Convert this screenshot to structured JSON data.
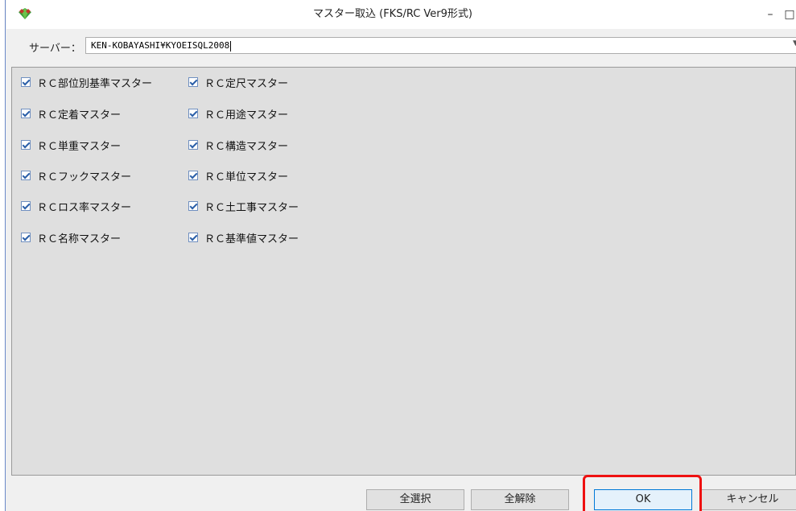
{
  "window": {
    "title": "マスター取込 (FKS/RC Ver9形式)",
    "icon": "app-logo-icon",
    "controls": {
      "minimize": "–",
      "maximize": "□",
      "close": "✕"
    }
  },
  "server": {
    "label": "サーバー：",
    "value": "KEN-KOBAYASHI¥KYOEISQL2008"
  },
  "masters": {
    "left": [
      {
        "label": "ＲＣ部位別基準マスター",
        "checked": true
      },
      {
        "label": "ＲＣ定着マスター",
        "checked": true
      },
      {
        "label": "ＲＣ単重マスター",
        "checked": true
      },
      {
        "label": "ＲＣフックマスター",
        "checked": true
      },
      {
        "label": "ＲＣロス率マスター",
        "checked": true
      },
      {
        "label": "ＲＣ名称マスター",
        "checked": true
      }
    ],
    "right": [
      {
        "label": "ＲＣ定尺マスター",
        "checked": true
      },
      {
        "label": "ＲＣ用途マスター",
        "checked": true
      },
      {
        "label": "ＲＣ構造マスター",
        "checked": true
      },
      {
        "label": "ＲＣ単位マスター",
        "checked": true
      },
      {
        "label": "ＲＣ土工事マスター",
        "checked": true
      },
      {
        "label": "ＲＣ基準値マスター",
        "checked": true
      }
    ]
  },
  "buttons": {
    "select_all": "全選択",
    "deselect_all": "全解除",
    "ok": "OK",
    "cancel": "キャンセル"
  },
  "colors": {
    "highlight": "#ee1111",
    "check": "#2b5fa8",
    "panel": "#dfdfdf"
  }
}
